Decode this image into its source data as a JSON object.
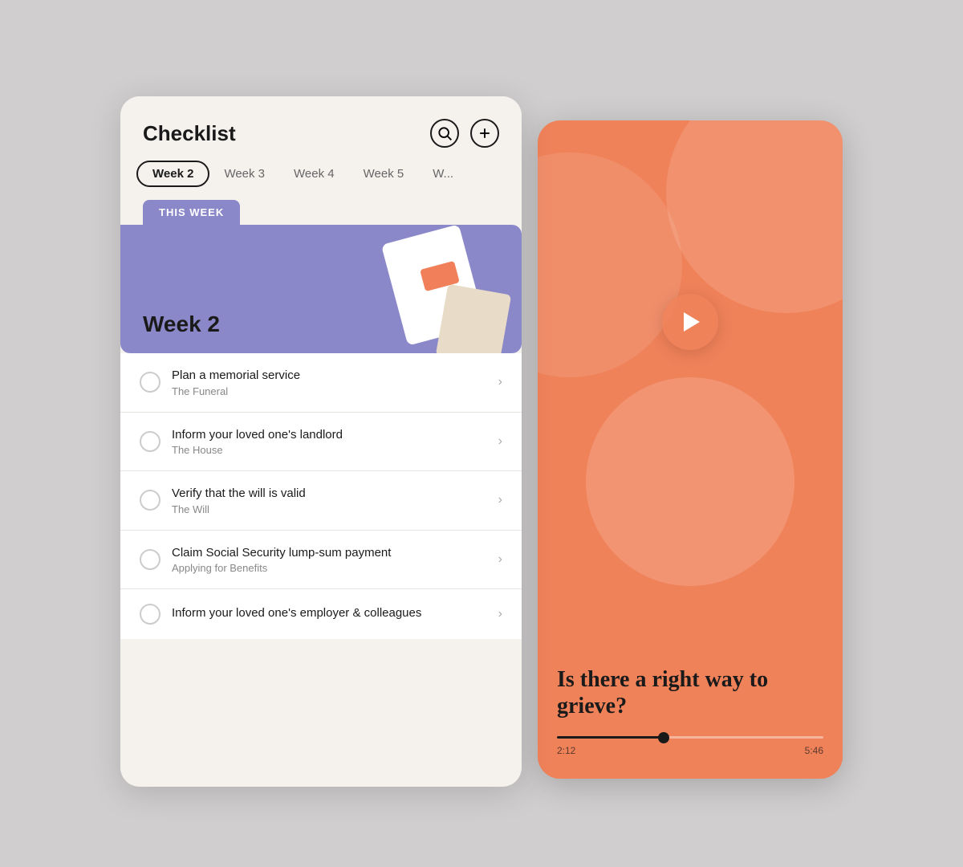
{
  "checklist": {
    "title": "Checklist",
    "tabs": [
      {
        "label": "Week 2",
        "active": true
      },
      {
        "label": "Week 3",
        "active": false
      },
      {
        "label": "Week 4",
        "active": false
      },
      {
        "label": "Week 5",
        "active": false
      },
      {
        "label": "W...",
        "active": false
      }
    ],
    "this_week_label": "THIS WEEK",
    "week_card_title": "Week 2",
    "items": [
      {
        "title": "Plan a memorial service",
        "subtitle": "The Funeral"
      },
      {
        "title": "Inform your loved one's landlord",
        "subtitle": "The House"
      },
      {
        "title": "Verify that the will is valid",
        "subtitle": "The Will"
      },
      {
        "title": "Claim Social Security lump-sum payment",
        "subtitle": "Applying for Benefits"
      },
      {
        "title": "Inform your loved one's employer & colleagues",
        "subtitle": ""
      }
    ]
  },
  "video": {
    "title": "Is there a right way to grieve?",
    "time_current": "2:12",
    "time_total": "5:46",
    "progress_percent": 40
  },
  "icons": {
    "search": "🔍",
    "add": "+",
    "chevron": "›",
    "play": "▶"
  }
}
